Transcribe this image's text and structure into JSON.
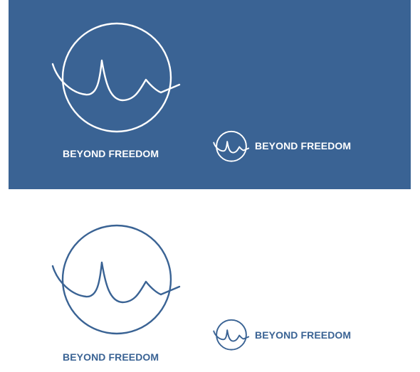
{
  "brand": {
    "name": "BEYOND FREEDOM"
  },
  "colors": {
    "brand_blue": "#3a6394",
    "white": "#ffffff"
  },
  "variants": {
    "dark_large": {
      "label": "BEYOND FREEDOM"
    },
    "dark_inline": {
      "label": "BEYOND FREEDOM"
    },
    "light_large": {
      "label": "BEYOND FREEDOM"
    },
    "light_inline": {
      "label": "BEYOND FREEDOM"
    }
  },
  "icons": {
    "mark": "circle-wave-logo-icon"
  }
}
